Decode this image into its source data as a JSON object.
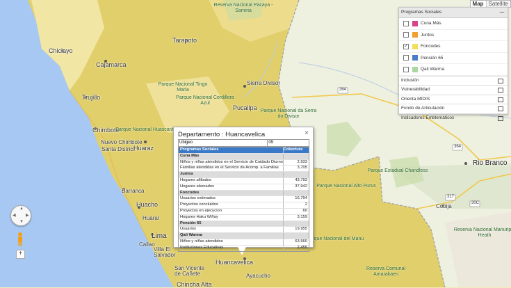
{
  "map_type": {
    "map_label": "Map",
    "satellite_label": "Satellite"
  },
  "legend": {
    "title": "Programas Sociales",
    "collapse_symbol": "—",
    "programs": [
      {
        "label": "Cuna Más",
        "color": "#d9438c",
        "checked": false
      },
      {
        "label": "Juntos",
        "color": "#f0a030",
        "checked": false
      },
      {
        "label": "Foncodes",
        "color": "#f2e05a",
        "checked": true
      },
      {
        "label": "Pensión 65",
        "color": "#4a7fc8",
        "checked": false
      },
      {
        "label": "Qali Warma",
        "color": "#a9d8a0",
        "checked": false
      }
    ],
    "sections": [
      {
        "label": "Inclusión"
      },
      {
        "label": "Vulnerabilidad"
      },
      {
        "label": "Orienta MIDIS"
      },
      {
        "label": "Fondo de Articulación"
      },
      {
        "label": "Indicadores Emblemáticos"
      }
    ]
  },
  "places": {
    "chiclayo": "Chiclayo",
    "cajamarca": "Cajamarca",
    "trujillo": "Trujillo",
    "chimbote": "Chimbote",
    "nuevo_chimbote": "Nuevo Chimbote",
    "santa_district": "Santa District",
    "huaraz": "Huaraz",
    "barranca": "Barranca",
    "huacho": "Huacho",
    "huaral": "Huaral",
    "lima": "Lima",
    "callao": "Callao",
    "villa_el_salvador": "Villa El Salvador",
    "san_vicente": "San Vicente de Cañete",
    "chincha": "Chincha Alta",
    "huancavelica": "Huancavelica",
    "ayacucho": "Ayacucho",
    "tarapoto": "Tarapoto",
    "pucallpa": "Pucallpa",
    "sierra_divisor": "Sierra Divisor",
    "rio_branco": "Rio Branco",
    "cobija": "Cobija",
    "pacaya": "Reserva Nacional Pacaya - Samiria",
    "cordillera_azul": "Parque Nacional Cordillera Azul",
    "huascaran": "Parque Nacional Huascarán",
    "tingo": "Parque Nacional Tingo Maria",
    "serra_divisor": "Parque Nacional da Serra do Divisor",
    "chandless": "Parque Estadual Chandless",
    "alto_purus": "Parque Nacional Alto Purus",
    "manu": "Parque Nacional del Manu",
    "amarakaeri": "Reserva Comunal Amarakaeri",
    "manuripi": "Reserva Nacional Manuripi - Heath",
    "rt_364a": "364",
    "rt_364b": "364",
    "rt_364c": "364",
    "rt_317": "317",
    "rt_30c": "30C"
  },
  "info_window": {
    "title": "Departamento : Huancavelica",
    "close_symbol": "×",
    "ubigeo_label": "Ubigeo",
    "ubigeo_value": "09",
    "col_program": "Programas Sociales",
    "col_coverage": "Cobertura",
    "rows": [
      {
        "label": "Cuna Más",
        "value": "",
        "group": true
      },
      {
        "label": "Niños y niñas atendidos en el Servicio de Cuidado Diurno",
        "value": "2,933",
        "group": false
      },
      {
        "label": "Familias atendidas en el Servicio de Acomp. a Familias",
        "value": "3,705",
        "group": false
      },
      {
        "label": "Juntos",
        "value": "",
        "group": true
      },
      {
        "label": "Hogares afiliados",
        "value": "43,793",
        "group": false
      },
      {
        "label": "Hogares abonados",
        "value": "37,942",
        "group": false
      },
      {
        "label": "Foncodes",
        "value": "",
        "group": true
      },
      {
        "label": "Usuarios estimados",
        "value": "16,794",
        "group": false
      },
      {
        "label": "Proyectos concluidos",
        "value": "2",
        "group": false
      },
      {
        "label": "Proyectos en ejecucion",
        "value": "60",
        "group": false
      },
      {
        "label": "Hogares Haku Wiñay",
        "value": "3,159",
        "group": false
      },
      {
        "label": "Pensión 65",
        "value": "",
        "group": true
      },
      {
        "label": "Usuarios",
        "value": "19,955",
        "group": false
      },
      {
        "label": "Qali Warma",
        "value": "",
        "group": true
      },
      {
        "label": "Niños y niñas atendidos",
        "value": "63,560",
        "group": false
      },
      {
        "label": "Instituciones Educativas",
        "value": "2,455",
        "group": false
      }
    ]
  },
  "controls": {
    "zoom_in": "+"
  }
}
